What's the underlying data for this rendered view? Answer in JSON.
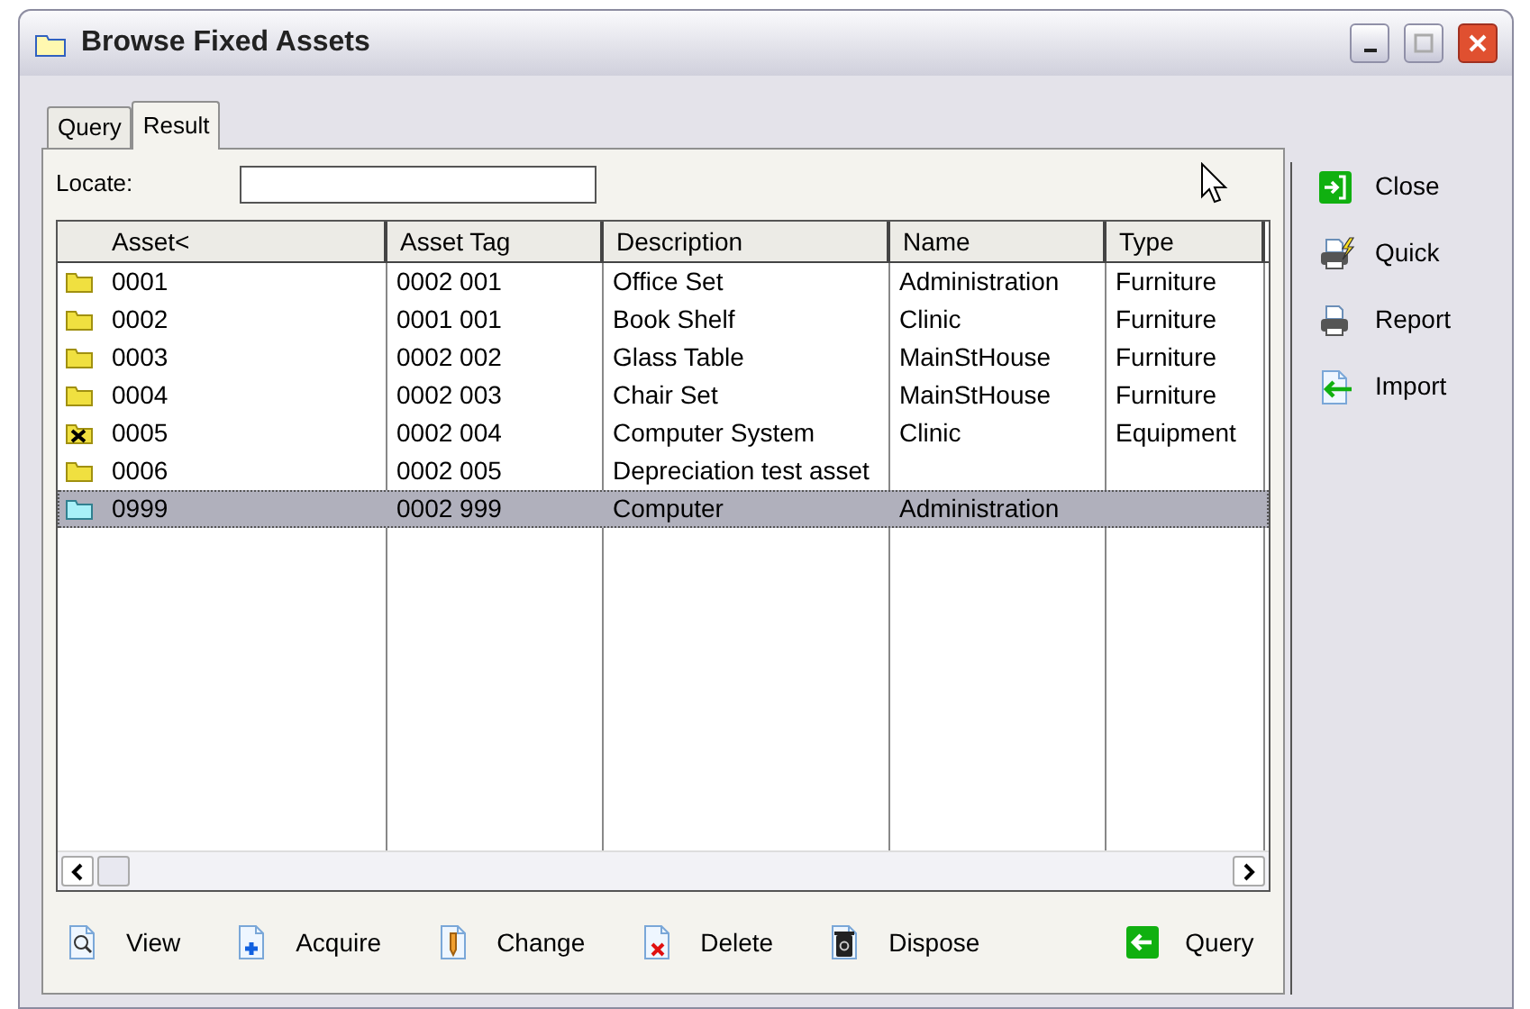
{
  "window": {
    "title": "Browse Fixed Assets"
  },
  "tabs": [
    {
      "label": "Query",
      "selected": false
    },
    {
      "label": "Result",
      "selected": true
    }
  ],
  "locate": {
    "label": "Locate:"
  },
  "table": {
    "columns": [
      "Asset<",
      "Asset Tag",
      "Description",
      "Name",
      "Type"
    ],
    "rows": [
      {
        "cells": [
          "0001",
          "0002 001",
          "Office Set",
          "Administration",
          "Furniture"
        ],
        "disposed": false,
        "selected": false
      },
      {
        "cells": [
          "0002",
          "0001 001",
          "Book Shelf",
          "Clinic",
          "Furniture"
        ],
        "disposed": false,
        "selected": false
      },
      {
        "cells": [
          "0003",
          "0002 002",
          "Glass Table",
          "MainStHouse",
          "Furniture"
        ],
        "disposed": false,
        "selected": false
      },
      {
        "cells": [
          "0004",
          "0002 003",
          "Chair Set",
          "MainStHouse",
          "Furniture"
        ],
        "disposed": false,
        "selected": false
      },
      {
        "cells": [
          "0005",
          "0002 004",
          "Computer System",
          "Clinic",
          "Equipment"
        ],
        "disposed": true,
        "selected": false
      },
      {
        "cells": [
          "0006",
          "0002 005",
          "Depreciation test asset",
          "",
          ""
        ],
        "disposed": false,
        "selected": false
      },
      {
        "cells": [
          "0999",
          "0002 999",
          "Computer",
          "Administration",
          ""
        ],
        "disposed": false,
        "selected": true
      }
    ]
  },
  "bottom_buttons": [
    {
      "kind": "view",
      "label": "View"
    },
    {
      "kind": "acquire",
      "label": "Acquire"
    },
    {
      "kind": "change",
      "label": "Change"
    },
    {
      "kind": "delete",
      "label": "Delete"
    },
    {
      "kind": "dispose",
      "label": "Dispose"
    },
    {
      "kind": "query",
      "label": "Query"
    }
  ],
  "side_buttons": [
    {
      "kind": "close",
      "label": "Close"
    },
    {
      "kind": "quick",
      "label": "Quick"
    },
    {
      "kind": "report",
      "label": "Report"
    },
    {
      "kind": "import",
      "label": "Import"
    }
  ]
}
